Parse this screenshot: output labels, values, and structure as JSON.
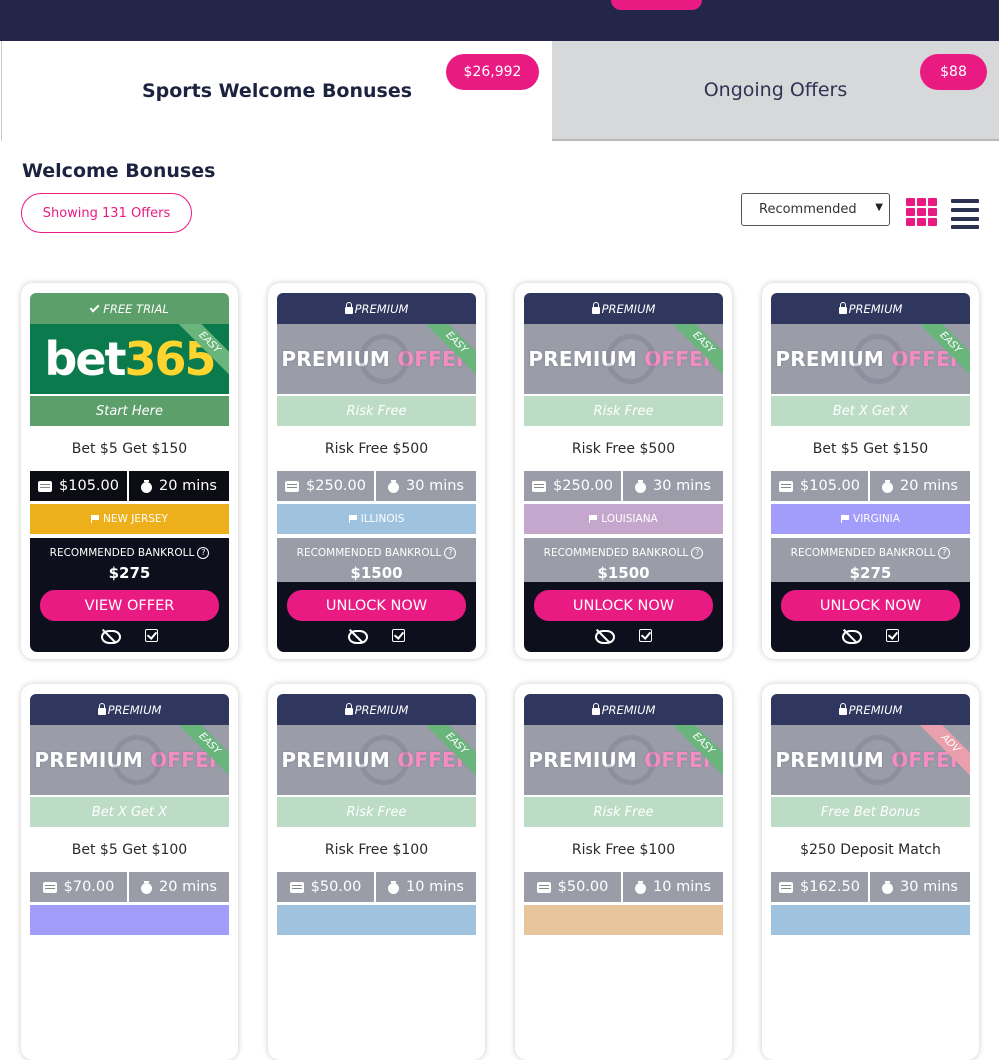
{
  "tabs": [
    {
      "label": "Sports Welcome Bonuses",
      "badge": "$26,992"
    },
    {
      "label": "Ongoing Offers",
      "badge": "$88"
    }
  ],
  "section_title": "Welcome Bonuses",
  "showing_label": "Showing 131 Offers",
  "sort": {
    "selected": "Recommended"
  },
  "bankroll_label": "RECOMMENDED BANKROLL",
  "colors": {
    "accent": "#ea1a83",
    "navy": "#232648"
  },
  "cards": [
    {
      "header": "FREE TRIAL",
      "hero": "bet365",
      "logo_a": "bet",
      "logo_b": "365",
      "difficulty": "EASY",
      "sub": "Start Here",
      "title": "Bet $5 Get $150",
      "money": "$105.00",
      "time": "20 mins",
      "state": "NEW JERSEY",
      "state_color": "#eeb01a",
      "bankroll": "$275",
      "cta": "VIEW OFFER"
    },
    {
      "header": "PREMIUM",
      "hero_a": "PREMIUM",
      "hero_b": "OFFER",
      "difficulty": "EASY",
      "sub": "Risk Free",
      "title": "Risk Free $500",
      "money": "$250.00",
      "time": "30 mins",
      "state": "ILLINOIS",
      "state_color": "#9fc2df",
      "bankroll": "$1500",
      "cta": "UNLOCK NOW"
    },
    {
      "header": "PREMIUM",
      "hero_a": "PREMIUM",
      "hero_b": "OFFER",
      "difficulty": "EASY",
      "sub": "Risk Free",
      "title": "Risk Free $500",
      "money": "$250.00",
      "time": "30 mins",
      "state": "LOUISIANA",
      "state_color": "#c5a6cc",
      "bankroll": "$1500",
      "cta": "UNLOCK NOW"
    },
    {
      "header": "PREMIUM",
      "hero_a": "PREMIUM",
      "hero_b": "OFFER",
      "difficulty": "EASY",
      "sub": "Bet X Get X",
      "title": "Bet $5 Get $150",
      "money": "$105.00",
      "time": "20 mins",
      "state": "VIRGINIA",
      "state_color": "#a29cfb",
      "bankroll": "$275",
      "cta": "UNLOCK NOW"
    },
    {
      "header": "PREMIUM",
      "hero_a": "PREMIUM",
      "hero_b": "OFFER",
      "difficulty": "EASY",
      "sub": "Bet X Get X",
      "title": "Bet $5 Get $100",
      "money": "$70.00",
      "time": "20 mins"
    },
    {
      "header": "PREMIUM",
      "hero_a": "PREMIUM",
      "hero_b": "OFFER",
      "difficulty": "EASY",
      "sub": "Risk Free",
      "title": "Risk Free $100",
      "money": "$50.00",
      "time": "10 mins"
    },
    {
      "header": "PREMIUM",
      "hero_a": "PREMIUM",
      "hero_b": "OFFER",
      "difficulty": "EASY",
      "sub": "Risk Free",
      "title": "Risk Free $100",
      "money": "$50.00",
      "time": "10 mins"
    },
    {
      "header": "PREMIUM",
      "hero_a": "PREMIUM",
      "hero_b": "OFFER",
      "difficulty": "ADV",
      "sub": "Free Bet Bonus",
      "title": "$250 Deposit Match",
      "money": "$162.50",
      "time": "30 mins"
    }
  ]
}
